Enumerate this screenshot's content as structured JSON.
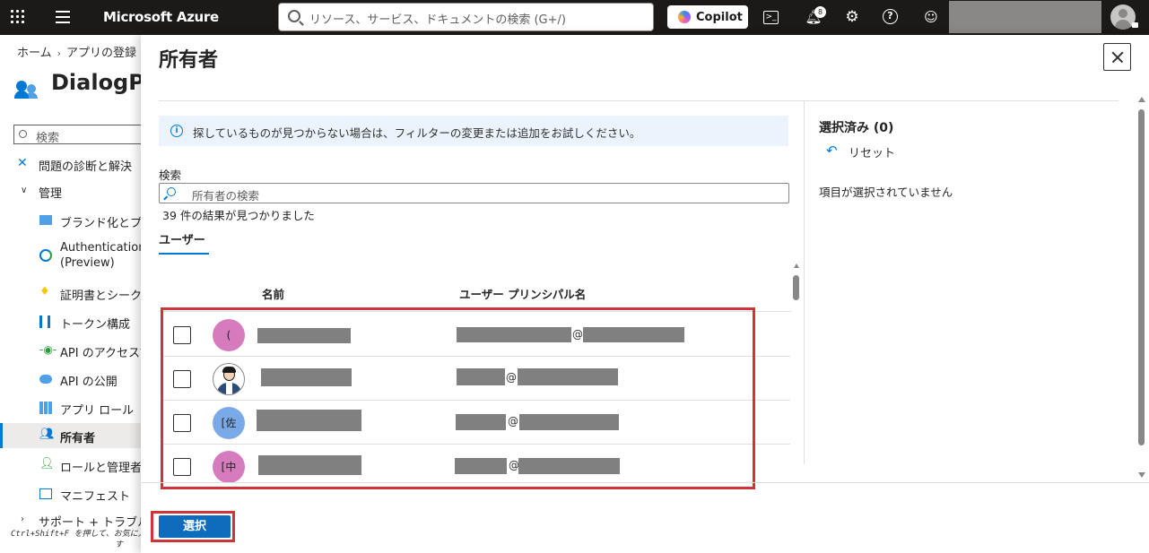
{
  "topbar": {
    "brand": "Microsoft Azure",
    "search_placeholder": "リソース、サービス、ドキュメントの検索 (G+/)",
    "copilot_label": "Copilot",
    "notification_count": "8"
  },
  "breadcrumb": {
    "home": "ホーム",
    "app_registrations": "アプリの登録"
  },
  "page": {
    "title": "DialogPla"
  },
  "sidebar": {
    "search_placeholder": "検索",
    "items": [
      {
        "label": "問題の診断と解決",
        "icon": "wrench-icon"
      },
      {
        "label": "管理",
        "icon": "chevron-down-icon"
      },
      {
        "label": "ブランド化とプロパ",
        "icon": "branding-icon"
      },
      {
        "label": "Authentication",
        "label2": "(Preview)",
        "icon": "authentication-icon"
      },
      {
        "label": "証明書とシークレッ",
        "icon": "key-icon"
      },
      {
        "label": "トークン構成",
        "icon": "token-icon"
      },
      {
        "label": "API のアクセス許",
        "icon": "api-permissions-icon"
      },
      {
        "label": "API の公開",
        "icon": "cloud-icon"
      },
      {
        "label": "アプリ ロール",
        "icon": "app-roles-icon"
      },
      {
        "label": "所有者",
        "icon": "owners-icon",
        "selected": true
      },
      {
        "label": "ロールと管理者",
        "icon": "roles-admins-icon"
      },
      {
        "label": "マニフェスト",
        "icon": "manifest-icon"
      },
      {
        "label": "サポート + トラブルシュ",
        "icon": "chevron-right-icon"
      }
    ],
    "shortcut_hint_line1": "Ctrl+Shift+F を押して、お気に入",
    "shortcut_hint_line2": "す"
  },
  "flyout": {
    "title": "所有者",
    "info_message": "探しているものが見つからない場合は、フィルターの変更または追加をお試しください。",
    "search_label": "検索",
    "search_placeholder": "所有者の検索",
    "result_count": "39 件の結果が見つかりました",
    "tab_users": "ユーザー",
    "columns": {
      "name": "名前",
      "upn": "ユーザー プリンシパル名"
    },
    "rows": [
      {
        "avatar_text": "(",
        "avatar_color": "#d77bbf",
        "at": "@"
      },
      {
        "avatar_text": "",
        "avatar_photo": true,
        "at": "@"
      },
      {
        "avatar_text": "[佐",
        "avatar_color": "#7aa9e8",
        "at": "@"
      },
      {
        "avatar_text": "[中",
        "avatar_color": "#d77bbf",
        "at": "@"
      }
    ],
    "selected_title": "選択済み (0)",
    "reset_label": "リセット",
    "none_selected": "項目が選択されていません",
    "select_button": "選択"
  },
  "colors": {
    "accent": "#0078d4",
    "highlight": "#d13438",
    "topbar": "#1b1a19"
  }
}
